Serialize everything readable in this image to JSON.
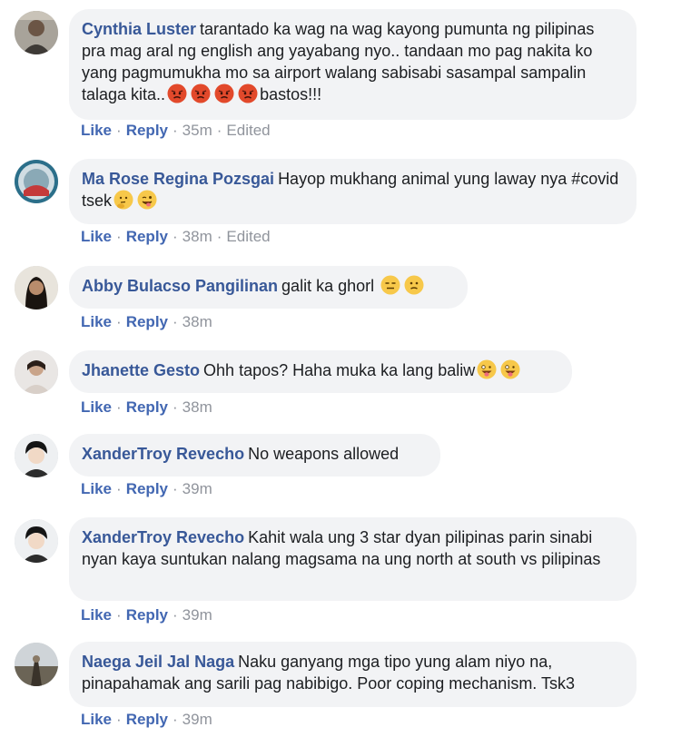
{
  "comments": [
    {
      "author": "Cynthia Luster",
      "text": "tarantado ka wag na wag kayong pumunta ng pilipinas pra mag aral ng english ang yayabang nyo.. tandaan mo pag nakita ko yang pagmumukha mo sa airport walang sabisabi sasampal sampalin talaga kita..",
      "text_after": "bastos!!!",
      "emojis": [
        "angry-face-emoji",
        "angry-face-emoji",
        "angry-face-emoji",
        "angry-face-emoji"
      ],
      "like": "Like",
      "reply": "Reply",
      "time": "35m",
      "edited": "Edited"
    },
    {
      "author": "Ma Rose Regina Pozsgai",
      "text": "Hayop mukhang animal yung laway nya #covid tsek",
      "emojis": [
        "thinking-face-emoji",
        "winking-tongue-face-emoji"
      ],
      "like": "Like",
      "reply": "Reply",
      "time": "38m",
      "edited": "Edited"
    },
    {
      "author": "Abby Bulacso Pangilinan",
      "text": "galit ka ghorl",
      "emojis": [
        "expressionless-face-emoji",
        "confused-face-emoji"
      ],
      "like": "Like",
      "reply": "Reply",
      "time": "38m"
    },
    {
      "author": "Jhanette Gesto",
      "text": "Ohh tapos? Haha muka ka lang baliw",
      "emojis": [
        "crazy-face-emoji",
        "crazy-face-emoji"
      ],
      "like": "Like",
      "reply": "Reply",
      "time": "38m"
    },
    {
      "author": "XanderTroy Revecho",
      "text": "No weapons allowed",
      "like": "Like",
      "reply": "Reply",
      "time": "39m"
    },
    {
      "author": "XanderTroy Revecho",
      "text": "Kahit wala ung 3 star dyan pilipinas parin sinabi nyan kaya suntukan nalang magsama na ung north at south vs pilipinas",
      "like": "Like",
      "reply": "Reply",
      "time": "39m"
    },
    {
      "author": "Naega Jeil Jal Naga",
      "text": "Naku ganyang mga tipo yung alam niyo na, pinapahamak ang sarili pag nabibigo. Poor coping mechanism. Tsk3",
      "like": "Like",
      "reply": "Reply",
      "time": "39m"
    }
  ],
  "separator": "·",
  "colors": {
    "author": "#385898",
    "link": "#4267b2",
    "bubble": "#f2f3f5",
    "meta": "#90949c"
  }
}
